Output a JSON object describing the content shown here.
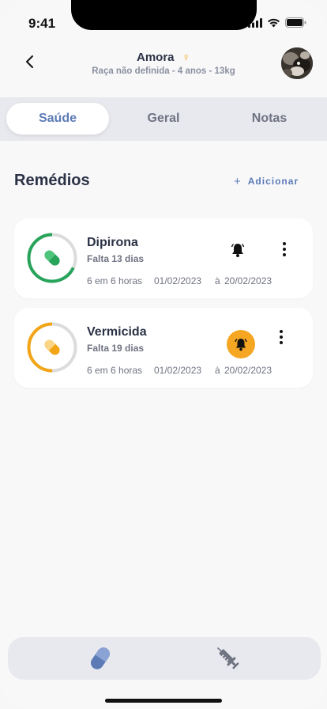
{
  "status_bar": {
    "time": "9:41"
  },
  "header": {
    "pet_name": "Amora",
    "gender_symbol": "♀",
    "subtitle": "Raça não definida - 4 anos - 13kg"
  },
  "tabs": [
    {
      "label": "Saúde",
      "active": true
    },
    {
      "label": "Geral",
      "active": false
    },
    {
      "label": "Notas",
      "active": false
    }
  ],
  "section": {
    "title": "Remédios",
    "add_label": "Adicionar"
  },
  "medications": [
    {
      "name": "Dipirona",
      "remaining": "Falta 13 dias",
      "frequency": "6 em 6 horas",
      "start_date": "01/02/2023",
      "end_prefix": "à",
      "end_date": "20/02/2023",
      "color": "#27a35a",
      "progress": 0.68,
      "bell_alert": false
    },
    {
      "name": "Vermicida",
      "remaining": "Falta 19 dias",
      "frequency": "6 em 6 horas",
      "start_date": "01/02/2023",
      "end_prefix": "à",
      "end_date": "20/02/2023",
      "color": "#f2a516",
      "progress": 0.5,
      "bell_alert": true
    }
  ],
  "bottom_nav": [
    {
      "icon": "pill-icon",
      "active": true
    },
    {
      "icon": "syringe-icon",
      "active": false
    }
  ]
}
